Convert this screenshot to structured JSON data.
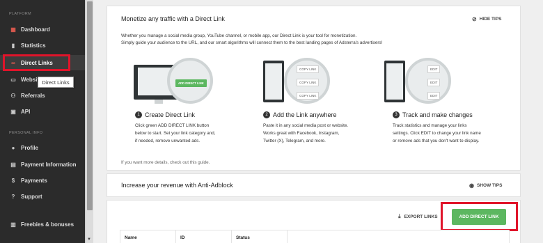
{
  "sidebar": {
    "section_platform": "PLATFORM",
    "section_personal": "PERSONAL INFO",
    "items": [
      {
        "label": "Dashboard",
        "icon": "dashboard-icon"
      },
      {
        "label": "Statistics",
        "icon": "bar-chart-icon"
      },
      {
        "label": "Direct Links",
        "icon": "link-icon"
      },
      {
        "label": "Websites",
        "icon": "monitor-icon"
      },
      {
        "label": "Referrals",
        "icon": "users-icon"
      },
      {
        "label": "API",
        "icon": "terminal-icon"
      },
      {
        "label": "Profile",
        "icon": "person-icon"
      },
      {
        "label": "Payment Information",
        "icon": "credit-card-icon"
      },
      {
        "label": "Payments",
        "icon": "dollar-icon"
      },
      {
        "label": "Support",
        "icon": "help-icon"
      },
      {
        "label": "Freebies & bonuses",
        "icon": "gift-icon"
      }
    ],
    "tooltip": "Direct Links"
  },
  "tips_card": {
    "title": "Monetize any traffic with a Direct Link",
    "hide_tips": "HIDE TIPS",
    "desc_line1": "Whether you manage a social media group, YouTube channel, or mobile app, our Direct Link is your tool for monetization.",
    "desc_line2": "Simply guide your audience to the URL, and our smart algorithms will connect them to the best landing pages of Adsterra's advertisers!",
    "illus1_button": "ADD DIRECT LINK",
    "illus2_rows": [
      "COPY LINK",
      "COPY LINK",
      "COPY LINK"
    ],
    "illus3_rows": [
      "EDIT",
      "EDIT",
      "EDIT"
    ],
    "steps": [
      {
        "num": "1",
        "title": "Create Direct Link",
        "lines": [
          "Click green ADD DIRECT LINK button",
          "below to start. Set your link category and,",
          "if needed, remove unwanted ads."
        ]
      },
      {
        "num": "2",
        "title": "Add the Link anywhere",
        "lines": [
          "Paste it in any social media post or website.",
          "Works great with Facebook, Instagram,",
          "Twitter (X), Telegram, and more."
        ]
      },
      {
        "num": "3",
        "title": "Track and make changes",
        "lines": [
          "Track statistics and manage your links",
          "settings. Click EDIT to change your link name",
          "or remove ads that you don't want to display."
        ]
      }
    ],
    "more": "If you want more details, check out this guide."
  },
  "adblock_card": {
    "title": "Increase your revenue with Anti-Adblock",
    "show_tips": "SHOW TIPS"
  },
  "links_card": {
    "export": "EXPORT LINKS",
    "add_button": "ADD DIRECT LINK",
    "columns": [
      "Name",
      "ID",
      "Status"
    ]
  },
  "colors": {
    "accent_green": "#5cb760",
    "highlight_red": "#e0142a",
    "sidebar_bg": "#2b2b2b"
  }
}
